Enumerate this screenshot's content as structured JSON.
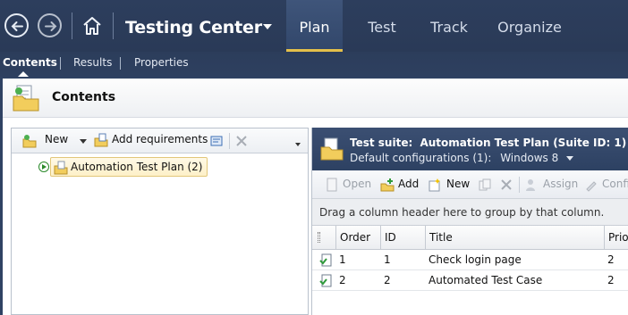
{
  "header": {
    "app_title": "Testing Center",
    "tabs": [
      {
        "label": "Plan",
        "active": true
      },
      {
        "label": "Test",
        "active": false
      },
      {
        "label": "Track",
        "active": false
      },
      {
        "label": "Organize",
        "active": false
      }
    ],
    "accent_color": "#e4c04a",
    "bar_color": "#2d3e5d"
  },
  "subnav": {
    "items": [
      {
        "label": "Contents",
        "active": true
      },
      {
        "label": "Results",
        "active": false
      },
      {
        "label": "Properties",
        "active": false
      }
    ]
  },
  "page": {
    "title": "Contents"
  },
  "left_panel": {
    "toolbar": {
      "new_label": "New",
      "add_requirements_label": "Add requirements"
    },
    "tree": {
      "root_label": "Automation Test Plan (2)"
    }
  },
  "right_panel": {
    "suite_label": "Test suite:",
    "suite_name": "Automation Test Plan (Suite ID: 1)",
    "config_label": "Default configurations (1):",
    "config_value": "Windows 8",
    "toolbar": {
      "open_label": "Open",
      "add_label": "Add",
      "new_label": "New",
      "assign_label": "Assign",
      "configure_label": "Confi"
    },
    "group_hint": "Drag a column header here to group by that column.",
    "columns": [
      "Order",
      "ID",
      "Title",
      "Prior"
    ],
    "rows": [
      {
        "order": "1",
        "id": "1",
        "title": "Check login page",
        "priority": "2"
      },
      {
        "order": "2",
        "id": "2",
        "title": "Automated Test Case",
        "priority": "2"
      }
    ]
  }
}
